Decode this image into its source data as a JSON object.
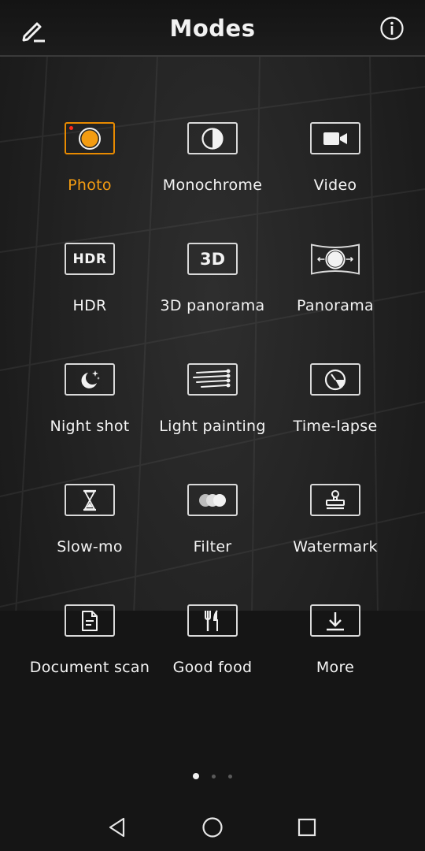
{
  "header": {
    "title": "Modes",
    "edit_icon": "pencil-icon",
    "info_icon": "info-icon"
  },
  "accent_color": "#f39c12",
  "modes": [
    {
      "label": "Photo",
      "icon": "shutter-circle-icon",
      "active": true
    },
    {
      "label": "Monochrome",
      "icon": "half-circle-icon",
      "active": false
    },
    {
      "label": "Video",
      "icon": "video-camera-icon",
      "active": false
    },
    {
      "label": "HDR",
      "icon": "hdr-icon",
      "active": false
    },
    {
      "label": "3D panorama",
      "icon": "3d-icon",
      "active": false
    },
    {
      "label": "Panorama",
      "icon": "panorama-icon",
      "active": false
    },
    {
      "label": "Night shot",
      "icon": "moon-stars-icon",
      "active": false
    },
    {
      "label": "Light painting",
      "icon": "light-streaks-icon",
      "active": false
    },
    {
      "label": "Time-lapse",
      "icon": "timer-dial-icon",
      "active": false
    },
    {
      "label": "Slow-mo",
      "icon": "hourglass-icon",
      "active": false
    },
    {
      "label": "Filter",
      "icon": "filter-circles-icon",
      "active": false
    },
    {
      "label": "Watermark",
      "icon": "stamp-icon",
      "active": false
    },
    {
      "label": "Document scan",
      "icon": "document-icon",
      "active": false
    },
    {
      "label": "Good food",
      "icon": "fork-knife-icon",
      "active": false
    },
    {
      "label": "More",
      "icon": "download-icon",
      "active": false
    }
  ],
  "icon_text": {
    "hdr": "HDR",
    "three_d": "3D"
  },
  "pager": {
    "pages": 3,
    "current": 1
  },
  "navbar": {
    "back_icon": "back-triangle-icon",
    "home_icon": "home-circle-icon",
    "recents_icon": "recents-square-icon"
  }
}
